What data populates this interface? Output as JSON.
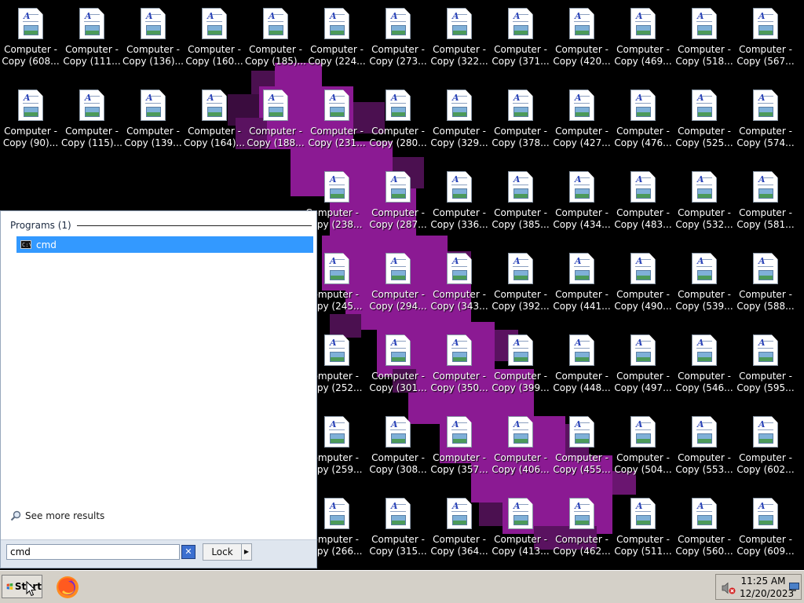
{
  "desktop": {
    "icon_name_line1": "Computer -",
    "columns": [
      [
        "Copy (608...",
        "Copy (90)...",
        "",
        "",
        "",
        "",
        ""
      ],
      [
        "Copy (111...",
        "Copy (115)...",
        "",
        "",
        "",
        "",
        ""
      ],
      [
        "Copy (136)...",
        "Copy (139...",
        "",
        "",
        "",
        "",
        ""
      ],
      [
        "Copy (160...",
        "Copy (164)...",
        "",
        "",
        "",
        "",
        ""
      ],
      [
        "Copy (185)...",
        "Copy (188...",
        "",
        "",
        "",
        "",
        ""
      ],
      [
        "Copy (224...",
        "Copy (231...",
        "opy (238...",
        "opy (245...",
        "opy (252...",
        "opy (259...",
        "opy (266..."
      ],
      [
        "Copy (273...",
        "Copy (280...",
        "Copy (287...",
        "Copy (294...",
        "Copy (301...",
        "Copy (308...",
        "Copy (315..."
      ],
      [
        "Copy (322...",
        "Copy (329...",
        "Copy (336...",
        "Copy (343...",
        "Copy (350...",
        "Copy (357...",
        "Copy (364..."
      ],
      [
        "Copy (371...",
        "Copy (378...",
        "Copy (385...",
        "Copy (392...",
        "Copy (399...",
        "Copy (406...",
        "Copy (413..."
      ],
      [
        "Copy (420...",
        "Copy (427...",
        "Copy (434...",
        "Copy (441...",
        "Copy (448...",
        "Copy (455...",
        "Copy (462..."
      ],
      [
        "Copy (469...",
        "Copy (476...",
        "Copy (483...",
        "Copy (490...",
        "Copy (497...",
        "Copy (504...",
        "Copy (511..."
      ],
      [
        "Copy (518...",
        "Copy (525...",
        "Copy (532...",
        "Copy (539...",
        "Copy (546...",
        "Copy (553...",
        "Copy (560..."
      ],
      [
        "Copy (567...",
        "Copy (574...",
        "Copy (581...",
        "Copy (588...",
        "Copy (595...",
        "Copy (602...",
        "Copy (609..."
      ]
    ]
  },
  "start_menu": {
    "programs_header": "Programs (1)",
    "results": [
      {
        "label": "cmd",
        "icon": "cmd-icon"
      }
    ],
    "see_more": "See more results",
    "search_value": "cmd",
    "lock_label": "Lock",
    "lock_arrow": "▶"
  },
  "taskbar": {
    "start_label": "Start",
    "clock_time": "11:25 AM",
    "clock_date": "12/20/2023"
  },
  "colors": {
    "wallpaper": "#000000",
    "wallpaper_accent": "#8b008b",
    "selection": "#3399ff"
  }
}
